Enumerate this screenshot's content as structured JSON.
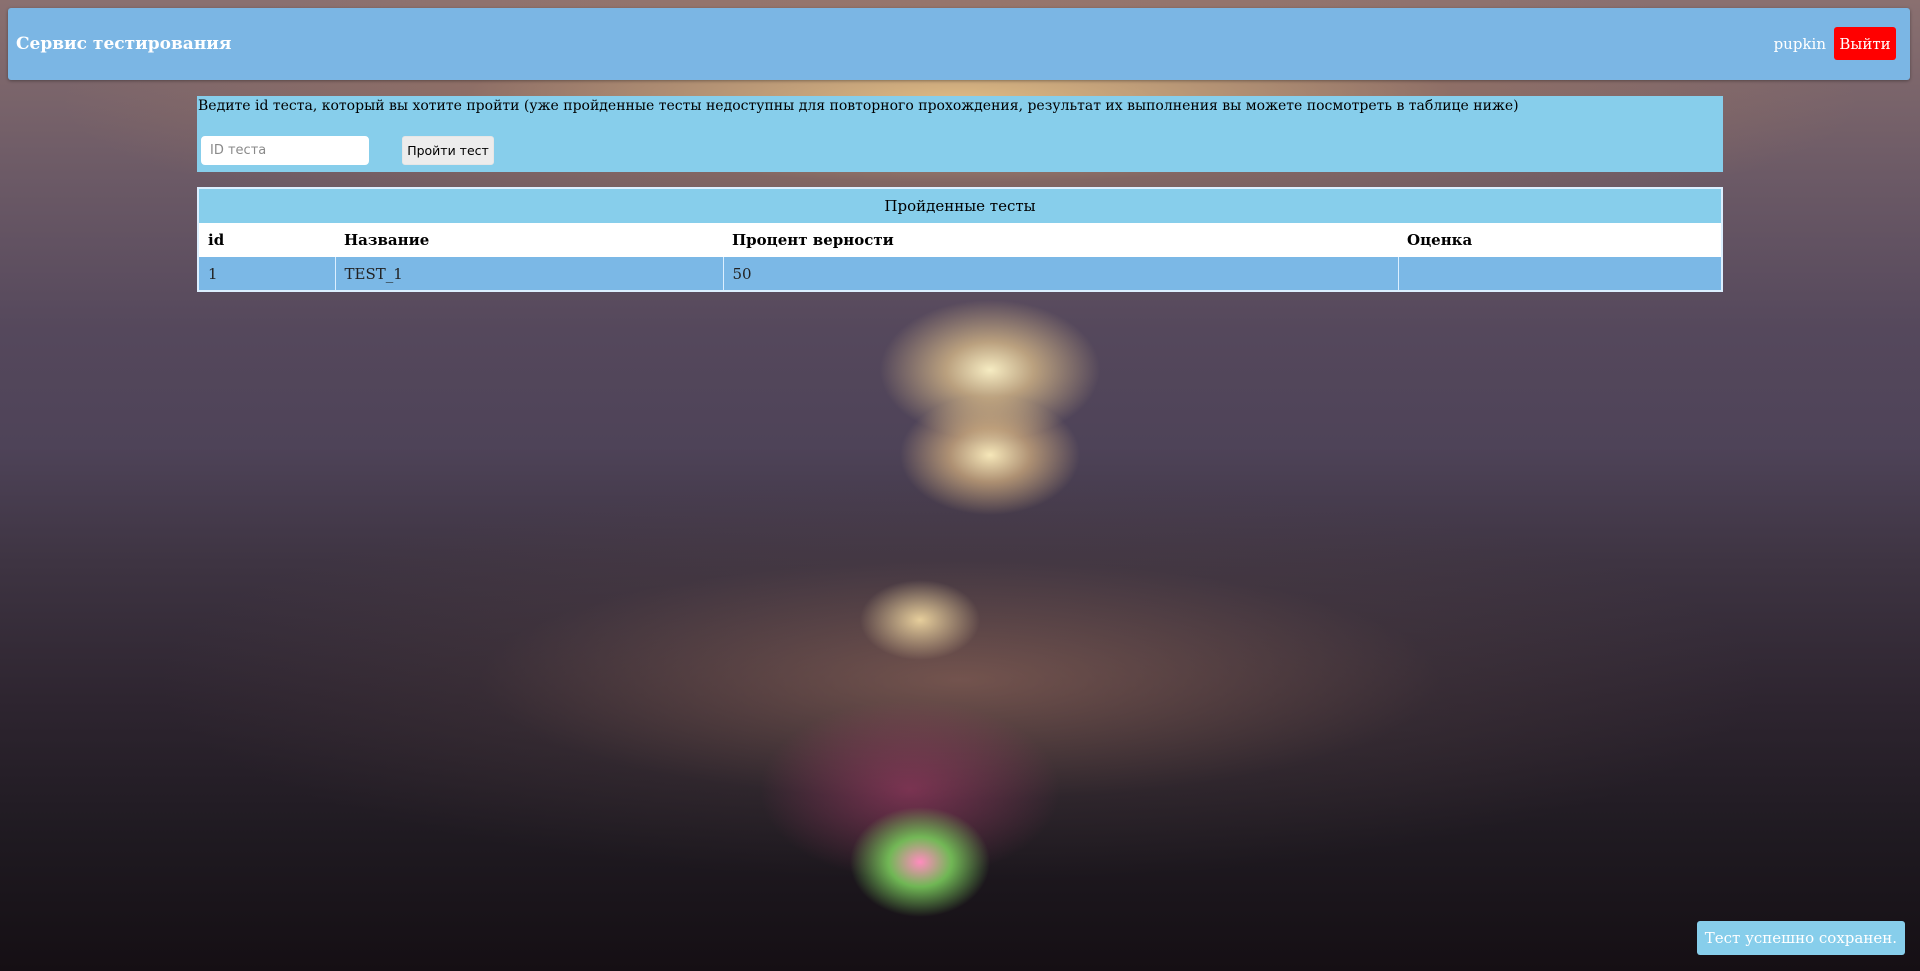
{
  "header": {
    "title": "Сервис тестирования",
    "username": "pupkin",
    "logout_label": "Выйти"
  },
  "test_form": {
    "instruction": "Ведите id теста, который вы хотите пройти (уже пройденные тесты недоступны для повторного прохождения, результат их выполнения вы можете посмотреть в таблице ниже)",
    "input_placeholder": "ID теста",
    "input_value": "",
    "submit_label": "Пройти тест"
  },
  "results": {
    "caption": "Пройденные тесты",
    "columns": [
      "id",
      "Название",
      "Процент верности",
      "Оценка"
    ],
    "rows": [
      [
        "1",
        "TEST_1",
        "50",
        ""
      ]
    ]
  },
  "notification": {
    "text": "Тест успешно сохранен."
  },
  "colors": {
    "header_bg": "#7bb6e4",
    "panel_bg": "#87ceeb",
    "row_bg": "#7bb8e6",
    "logout_bg": "#ff0000"
  }
}
